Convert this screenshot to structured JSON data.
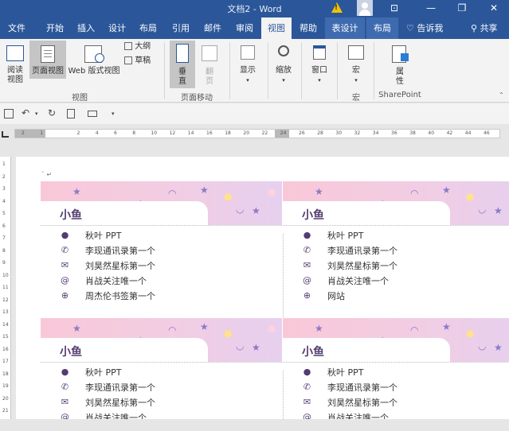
{
  "window": {
    "title": "文档2 - Word",
    "minimize": "—",
    "restore": "❐",
    "close": "✕",
    "ribbon_display": "⊡"
  },
  "tabs": [
    "文件",
    "开始",
    "插入",
    "设计",
    "布局",
    "引用",
    "邮件",
    "审阅",
    "视图",
    "帮助",
    "表设计",
    "布局"
  ],
  "active_tab": "视图",
  "tell_me": "告诉我",
  "share": "共享",
  "ribbon": {
    "views": {
      "read_mode": [
        "阅读",
        "视图"
      ],
      "print_layout": "页面视图",
      "web_layout": "Web 版式视图",
      "outline": "大纲",
      "draft": "草稿",
      "group_label": "视图"
    },
    "page_movement": {
      "vertical": [
        "垂",
        "直"
      ],
      "side_to_side": [
        "翻",
        "页"
      ],
      "group_label": "页面移动"
    },
    "show": "显示",
    "zoom": "缩放",
    "window": "窗口",
    "macros": "宏",
    "macros_group": "宏",
    "properties": [
      "属",
      "性"
    ],
    "sharepoint_group": "SharePoint"
  },
  "qat": {
    "save_icon": "save-icon",
    "undo_icon": "undo-icon",
    "redo_icon": "redo-icon"
  },
  "ruler": {
    "numbers": [
      "2",
      "1",
      "",
      "2",
      "4",
      "6",
      "8",
      "10",
      "12",
      "14",
      "16",
      "18",
      "20",
      "22",
      "24",
      "26",
      "28",
      "30",
      "32",
      "34",
      "36",
      "38",
      "40",
      "42",
      "44",
      "46"
    ]
  },
  "vruler": {
    "numbers": [
      "1",
      "2",
      "3",
      "4",
      "5",
      "6",
      "7",
      "8",
      "9",
      "10",
      "11",
      "12",
      "13",
      "14",
      "15",
      "16",
      "17",
      "18",
      "19",
      "20",
      "21"
    ]
  },
  "cards": [
    {
      "name": "小鱼",
      "rows": [
        {
          "icon": "location-icon",
          "text": "秋叶 PPT"
        },
        {
          "icon": "phone-icon",
          "text": "李现通讯录第一个"
        },
        {
          "icon": "mail-icon",
          "text": "刘昊然星标第一个"
        },
        {
          "icon": "at-icon",
          "text": "肖战关注唯一个"
        },
        {
          "icon": "globe-icon",
          "text": "周杰伦书签第一个"
        }
      ]
    },
    {
      "name": "小鱼",
      "rows": [
        {
          "icon": "location-icon",
          "text": "秋叶 PPT"
        },
        {
          "icon": "phone-icon",
          "text": "李现通讯录第一个"
        },
        {
          "icon": "mail-icon",
          "text": "刘昊然星标第一个"
        },
        {
          "icon": "at-icon",
          "text": "肖战关注唯一个"
        },
        {
          "icon": "globe-icon",
          "text": "网站"
        }
      ]
    },
    {
      "name": "小鱼",
      "rows": [
        {
          "icon": "location-icon",
          "text": "秋叶 PPT"
        },
        {
          "icon": "phone-icon",
          "text": "李现通讯录第一个"
        },
        {
          "icon": "mail-icon",
          "text": "刘昊然星标第一个"
        },
        {
          "icon": "at-icon",
          "text": "肖战关注唯一个"
        }
      ]
    },
    {
      "name": "小鱼",
      "rows": [
        {
          "icon": "location-icon",
          "text": "秋叶 PPT"
        },
        {
          "icon": "phone-icon",
          "text": "李现通讯录第一个"
        },
        {
          "icon": "mail-icon",
          "text": "刘昊然星标第一个"
        },
        {
          "icon": "at-icon",
          "text": "肖战关注唯一个"
        }
      ]
    }
  ],
  "colors": {
    "accent": "#2b579a",
    "card_text": "#553c70",
    "card_pink": "#f9c8d8"
  }
}
